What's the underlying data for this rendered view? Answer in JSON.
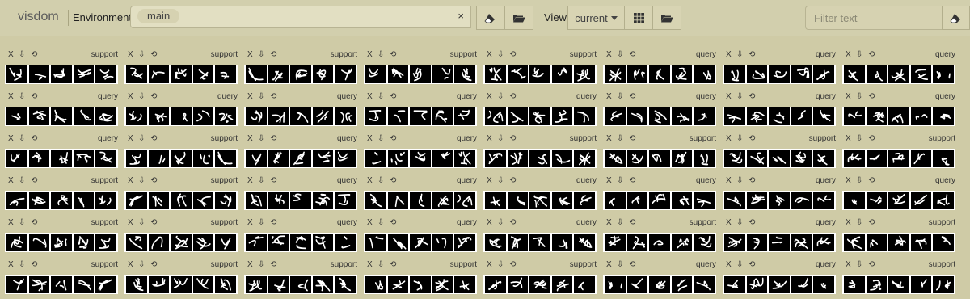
{
  "app": {
    "brand": "visdom"
  },
  "environment": {
    "label": "Environment",
    "selected": "main",
    "clear_symbol": "×"
  },
  "view": {
    "label": "View",
    "selected": "current"
  },
  "filter": {
    "placeholder": "Filter text"
  },
  "pane_controls": {
    "close": "X",
    "download": "⇩",
    "reset": "⟲"
  },
  "panes": [
    "support",
    "support",
    "support",
    "support",
    "support",
    "query",
    "query",
    "query",
    "query",
    "query",
    "query",
    "query",
    "query",
    "query",
    "query",
    "query",
    "query",
    "support",
    "query",
    "query",
    "support",
    "support",
    "support",
    "support",
    "support",
    "support",
    "query",
    "query",
    "query",
    "query",
    "query",
    "query",
    "support",
    "support",
    "query",
    "query",
    "query",
    "support",
    "query",
    "support",
    "support",
    "support",
    "support",
    "support",
    "support",
    "query",
    "query",
    "support"
  ]
}
